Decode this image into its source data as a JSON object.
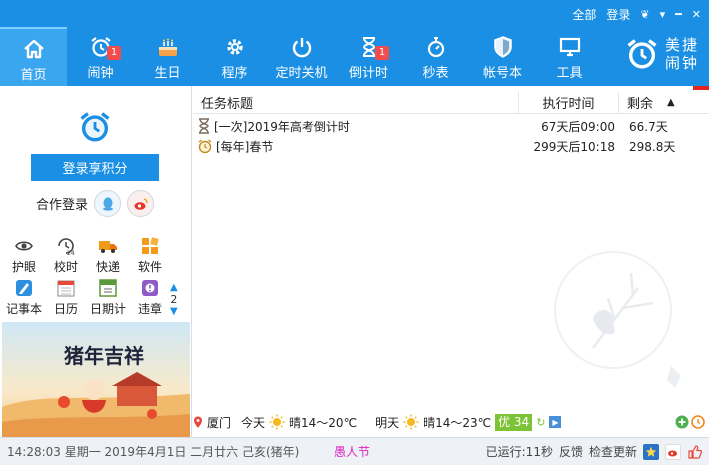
{
  "window": {
    "menu_all": "全部",
    "login": "登录",
    "controls": [
      "❦",
      "▾",
      "━",
      "✕"
    ]
  },
  "tabs": [
    {
      "label": "首页",
      "icon": "home-icon",
      "active": true
    },
    {
      "label": "闹钟",
      "icon": "alarm-clock-icon",
      "badge": "1"
    },
    {
      "label": "生日",
      "icon": "birthday-cake-icon"
    },
    {
      "label": "程序",
      "icon": "gear-icon"
    },
    {
      "label": "定时关机",
      "icon": "power-icon"
    },
    {
      "label": "倒计时",
      "icon": "hourglass-icon",
      "badge": "1"
    },
    {
      "label": "秒表",
      "icon": "stopwatch-icon"
    },
    {
      "label": "帐号本",
      "icon": "shield-icon"
    },
    {
      "label": "工具",
      "icon": "monitor-icon"
    }
  ],
  "brand": {
    "line1": "美捷",
    "line2": "闹钟"
  },
  "left": {
    "login_button": "登录享积分",
    "coop_label": "合作登录",
    "tools_row1": [
      "护眼",
      "校时",
      "快递",
      "软件"
    ],
    "tools_row2": [
      "记事本",
      "日历",
      "日期计",
      "违章"
    ],
    "page_number": "2",
    "banner_title": "猪年吉祥"
  },
  "tasks": {
    "headers": {
      "title": "任务标题",
      "time": "执行时间",
      "remaining": "剩余"
    },
    "rows": [
      {
        "title": "[一次]2019年高考倒计时",
        "time": "67天后09:00",
        "remaining": "66.7天",
        "icon": "hourglass-icon"
      },
      {
        "title": "[每年]春节",
        "time": "299天后10:18",
        "remaining": "298.8天",
        "icon": "alarm-clock-icon"
      }
    ]
  },
  "weather": {
    "city": "厦门",
    "today_label": "今天",
    "today": "晴14～20℃",
    "tomorrow_label": "明天",
    "tomorrow": "晴14～23℃",
    "aqi": "优 34"
  },
  "status": {
    "datetime": "14:28:03 星期一 2019年4月1日 二月廿六 己亥(猪年)",
    "holiday": "愚人节",
    "running": "已运行:11秒",
    "feedback": "反馈",
    "update": "检查更新"
  },
  "colors": {
    "accent": "#1a8fe3",
    "badge": "#f24c4c",
    "holiday": "#e020c0",
    "aqi": "#7cc336"
  }
}
